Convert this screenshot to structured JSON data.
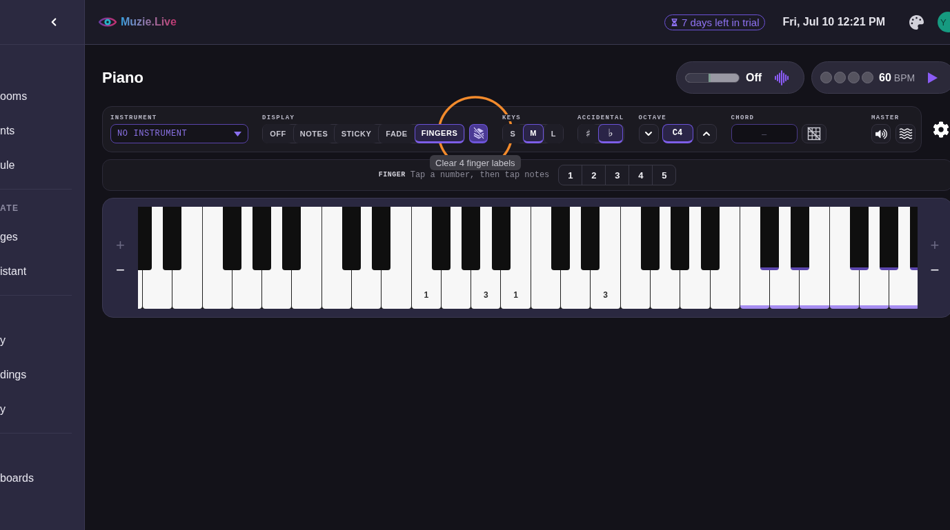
{
  "sidebar": {
    "sections": [
      {
        "items": [
          {
            "label": "ooms",
            "selected": false
          },
          {
            "label": "nts",
            "selected": false
          },
          {
            "label": "ule",
            "selected": false
          }
        ]
      },
      {
        "heading": "ATE",
        "items": [
          {
            "label": "ges",
            "selected": false
          },
          {
            "label": "istant",
            "selected": false
          }
        ]
      },
      {
        "items": [
          {
            "label": "y",
            "selected": false
          },
          {
            "label": "dings",
            "selected": false
          },
          {
            "label": "y",
            "selected": false
          }
        ]
      },
      {
        "items": [
          {
            "label": "boards",
            "selected": false
          }
        ]
      }
    ]
  },
  "top_bar": {
    "logo": "Muzie.Live",
    "trial_badge": "7 days left in trial",
    "datetime": "Fri, Jul 10 12:21 PM",
    "avatar_initials": "Y"
  },
  "page": {
    "title": "Piano",
    "monitor": {
      "level": 0.47,
      "status": "Off"
    },
    "metronome": {
      "beats": [
        {
          "active": false
        },
        {
          "active": false
        },
        {
          "active": false
        },
        {
          "active": false
        }
      ],
      "tempo": "60",
      "unit": "BPM"
    }
  },
  "controls": {
    "instrument": {
      "label": "INSTRUMENT",
      "value": "NO INSTRUMENT"
    },
    "display": {
      "label": "DISPLAY",
      "options": [
        {
          "label": "OFF",
          "selected": false
        },
        {
          "label": "NOTES",
          "selected": false
        },
        {
          "label": "STICKY",
          "selected": false
        },
        {
          "label": "FADE",
          "selected": false
        },
        {
          "label": "FINGERS",
          "selected": true
        }
      ]
    },
    "key_size": {
      "label": "KEYS",
      "options": [
        {
          "label": "S",
          "selected": false
        },
        {
          "label": "M",
          "selected": true
        },
        {
          "label": "L",
          "selected": false
        }
      ]
    },
    "accidental": {
      "label": "ACCIDENTAL",
      "options": [
        {
          "label": "♯",
          "selected": false
        },
        {
          "label": "♭",
          "selected": true
        }
      ]
    },
    "octave": {
      "label": "OCTAVE",
      "value": "C4"
    },
    "chord": {
      "label": "CHORD",
      "placeholder": "–"
    },
    "master": {
      "label": "MASTER"
    }
  },
  "tooltip": "Clear 4 finger labels",
  "finger_bar": {
    "label": "FINGER",
    "hint": "Tap a number, then tap notes",
    "numbers": [
      {
        "label": "1",
        "selected": false
      },
      {
        "label": "2",
        "selected": false
      },
      {
        "label": "3",
        "selected": false
      },
      {
        "label": "4",
        "selected": false
      },
      {
        "label": "5",
        "selected": false
      }
    ]
  },
  "piano": {
    "left_zoom": [
      {
        "label": "+",
        "disabled": true
      },
      {
        "label": "−",
        "disabled": false
      }
    ],
    "right_zoom": [
      {
        "label": "+",
        "disabled": true
      },
      {
        "label": "−",
        "disabled": false
      }
    ],
    "keys": [
      {
        "highlighted": false,
        "black_key": {
          "highlighted": false
        }
      },
      {
        "highlighted": false,
        "black_key": {
          "highlighted": false
        }
      },
      {
        "highlighted": false
      },
      {
        "highlighted": false,
        "black_key": {
          "highlighted": false
        }
      },
      {
        "highlighted": false,
        "black_key": {
          "highlighted": false
        }
      },
      {
        "highlighted": false,
        "black_key": {
          "highlighted": false
        }
      },
      {
        "highlighted": false
      },
      {
        "highlighted": false,
        "black_key": {
          "highlighted": false
        }
      },
      {
        "highlighted": false,
        "black_key": {
          "highlighted": false
        }
      },
      {
        "highlighted": false
      },
      {
        "highlighted": false,
        "finger": "1",
        "black_key": {
          "highlighted": false
        }
      },
      {
        "highlighted": false,
        "black_key": {
          "highlighted": false
        }
      },
      {
        "highlighted": false,
        "finger": "3",
        "black_key": {
          "highlighted": false
        }
      },
      {
        "highlighted": false,
        "finger": "1"
      },
      {
        "highlighted": false,
        "black_key": {
          "highlighted": false
        }
      },
      {
        "highlighted": false,
        "black_key": {
          "highlighted": false
        }
      },
      {
        "highlighted": false,
        "finger": "3"
      },
      {
        "highlighted": false,
        "black_key": {
          "highlighted": false
        }
      },
      {
        "highlighted": false,
        "black_key": {
          "highlighted": false
        }
      },
      {
        "highlighted": false,
        "black_key": {
          "highlighted": false
        }
      },
      {
        "highlighted": false
      },
      {
        "highlighted": true,
        "black_key": {
          "highlighted": true
        }
      },
      {
        "highlighted": true,
        "black_key": {
          "highlighted": true
        }
      },
      {
        "highlighted": true
      },
      {
        "highlighted": true,
        "black_key": {
          "highlighted": true
        }
      },
      {
        "highlighted": true,
        "black_key": {
          "highlighted": true
        }
      },
      {
        "highlighted": true,
        "black_key": {
          "highlighted": true
        }
      }
    ]
  }
}
